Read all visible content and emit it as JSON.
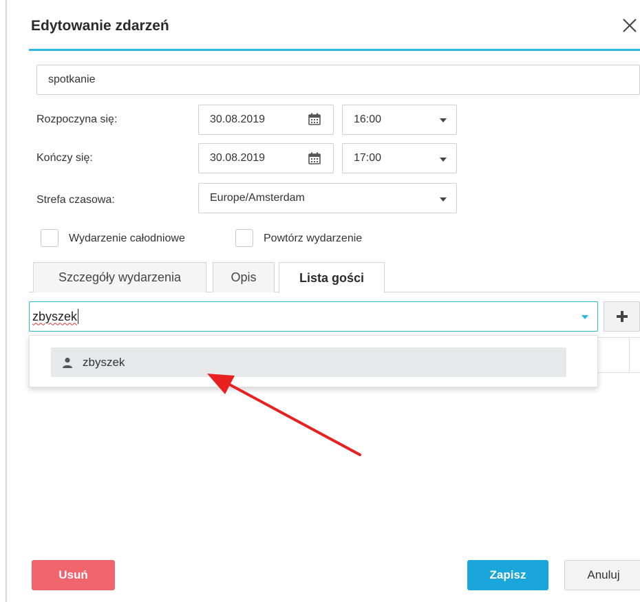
{
  "dialog": {
    "title": "Edytowanie zdarzeń"
  },
  "form": {
    "event_title_value": "spotkanie",
    "start": {
      "label": "Rozpoczyna się:",
      "date": "30.08.2019",
      "time": "16:00"
    },
    "end": {
      "label": "Kończy się:",
      "date": "30.08.2019",
      "time": "17:00"
    },
    "timezone": {
      "label": "Strefa czasowa:",
      "value": "Europe/Amsterdam"
    },
    "all_day_label": "Wydarzenie całodniowe",
    "repeat_label": "Powtórz wydarzenie"
  },
  "tabs": [
    {
      "label": "Szczegóły wydarzenia",
      "active": false
    },
    {
      "label": "Opis",
      "active": false
    },
    {
      "label": "Lista gości",
      "active": true
    }
  ],
  "guests": {
    "input_value": "zbyszek",
    "suggestions": [
      {
        "label": "zbyszek",
        "icon": "user-icon"
      }
    ]
  },
  "footer": {
    "delete_label": "Usuń",
    "save_label": "Zapisz",
    "cancel_label": "Anuluj"
  },
  "colors": {
    "accent": "#29b6e5",
    "delete": "#f0646e",
    "save": "#1aa6da",
    "annotation_arrow": "#e8201f"
  }
}
